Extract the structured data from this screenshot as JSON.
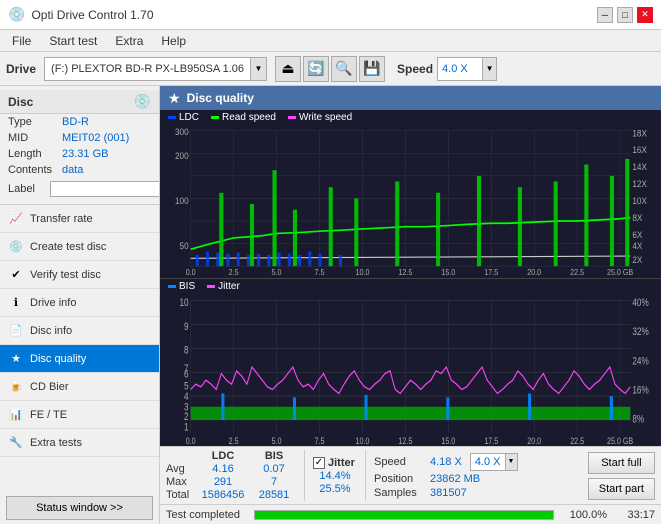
{
  "app": {
    "title": "Opti Drive Control 1.70",
    "icon": "💿"
  },
  "titlebar": {
    "minimize": "─",
    "maximize": "□",
    "close": "✕"
  },
  "menu": {
    "items": [
      "File",
      "Start test",
      "Extra",
      "Help"
    ]
  },
  "drive_bar": {
    "drive_label": "Drive",
    "drive_value": "(F:) PLEXTOR BD-R  PX-LB950SA 1.06",
    "speed_label": "Speed",
    "speed_value": "4.0 X"
  },
  "disc": {
    "section_title": "Disc",
    "fields": [
      {
        "label": "Type",
        "value": "BD-R"
      },
      {
        "label": "MID",
        "value": "MEIT02 (001)"
      },
      {
        "label": "Length",
        "value": "23.31 GB"
      },
      {
        "label": "Contents",
        "value": "data"
      }
    ],
    "label_field": "Label"
  },
  "nav": {
    "items": [
      {
        "id": "transfer-rate",
        "label": "Transfer rate",
        "icon": "📈"
      },
      {
        "id": "create-test-disc",
        "label": "Create test disc",
        "icon": "💿"
      },
      {
        "id": "verify-test-disc",
        "label": "Verify test disc",
        "icon": "✔"
      },
      {
        "id": "drive-info",
        "label": "Drive info",
        "icon": "ℹ"
      },
      {
        "id": "disc-info",
        "label": "Disc info",
        "icon": "📄"
      },
      {
        "id": "disc-quality",
        "label": "Disc quality",
        "icon": "★",
        "active": true
      },
      {
        "id": "cd-bier",
        "label": "CD Bier",
        "icon": "🍺"
      },
      {
        "id": "fe-te",
        "label": "FE / TE",
        "icon": "📊"
      },
      {
        "id": "extra-tests",
        "label": "Extra tests",
        "icon": "🔧"
      }
    ],
    "status_btn": "Status window >>"
  },
  "chart": {
    "title": "Disc quality",
    "icon": "★",
    "legend": [
      {
        "label": "LDC",
        "color": "#0044ff"
      },
      {
        "label": "Read speed",
        "color": "#00ff00"
      },
      {
        "label": "Write speed",
        "color": "#ff44ff"
      }
    ],
    "top": {
      "y_left_max": 300,
      "y_right_labels": [
        "18X",
        "16X",
        "14X",
        "12X",
        "10X",
        "8X",
        "6X",
        "4X",
        "2X"
      ],
      "x_labels": [
        "0.0",
        "2.5",
        "5.0",
        "7.5",
        "10.0",
        "12.5",
        "15.0",
        "17.5",
        "20.0",
        "22.5",
        "25.0 GB"
      ]
    },
    "bottom": {
      "legend": [
        {
          "label": "BIS",
          "color": "#0088ff"
        },
        {
          "label": "Jitter",
          "color": "#ff44ff"
        }
      ],
      "y_left_max": 10,
      "y_right_labels": [
        "40%",
        "32%",
        "24%",
        "16%",
        "8%"
      ],
      "x_labels": [
        "0.0",
        "2.5",
        "5.0",
        "7.5",
        "10.0",
        "12.5",
        "15.0",
        "17.5",
        "20.0",
        "22.5",
        "25.0 GB"
      ]
    }
  },
  "stats": {
    "columns": [
      "LDC",
      "BIS"
    ],
    "jitter_label": "Jitter",
    "jitter_checked": true,
    "rows": [
      {
        "label": "Avg",
        "ldc": "4.16",
        "bis": "0.07",
        "jitter": "14.4%"
      },
      {
        "label": "Max",
        "ldc": "291",
        "bis": "7",
        "jitter": "25.5%"
      },
      {
        "label": "Total",
        "ldc": "1586456",
        "bis": "28581",
        "jitter": ""
      }
    ],
    "speed_label": "Speed",
    "speed_value": "4.18 X",
    "speed_select": "4.0 X",
    "position_label": "Position",
    "position_value": "23862 MB",
    "samples_label": "Samples",
    "samples_value": "381507",
    "start_full": "Start full",
    "start_part": "Start part"
  },
  "progress": {
    "status": "Test completed",
    "percent": 100,
    "percent_text": "100.0%",
    "time": "33:17"
  }
}
